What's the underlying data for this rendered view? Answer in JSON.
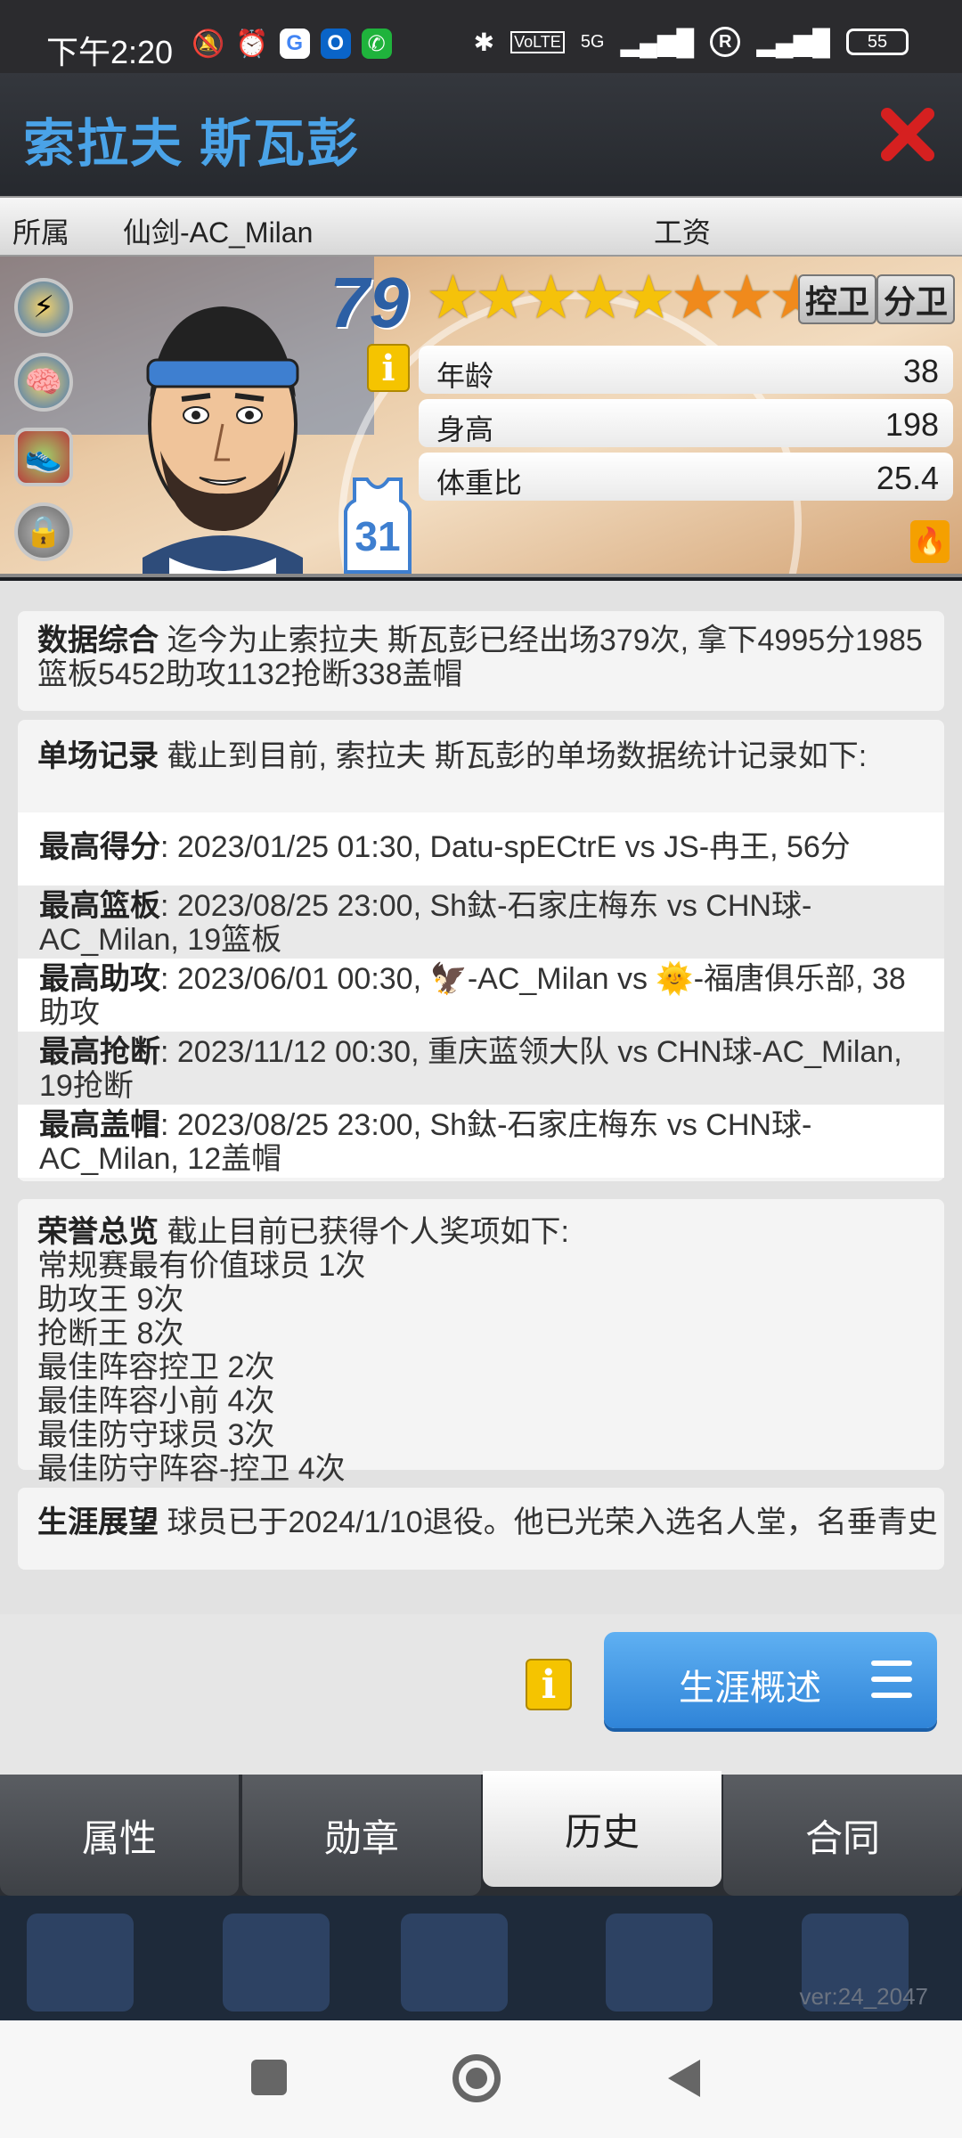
{
  "status_bar": {
    "time": "下午2:20",
    "network": "5G",
    "battery": "55",
    "registered_mark": "R"
  },
  "header": {
    "title": "索拉夫 斯瓦彭",
    "accent_color": "#4aa3e8",
    "close_icon_color": "#d62020"
  },
  "info_row": {
    "team_label": "所属",
    "team_value": "仙剑-AC_Milan",
    "salary_label": "工资"
  },
  "player": {
    "rating": "79",
    "stars_gold": 5,
    "stars_orange": 3,
    "positions": [
      "控卫",
      "分卫"
    ],
    "jersey_number": "31",
    "stats": [
      {
        "label": "年龄",
        "value": "38"
      },
      {
        "label": "身高",
        "value": "198"
      },
      {
        "label": "体重比",
        "value": "25.4"
      }
    ],
    "info_button": "i"
  },
  "summary": {
    "heading": "数据综合",
    "text": " 迄今为止索拉夫 斯瓦彭已经出场379次, 拿下4995分1985篮板5452助攻1132抢断338盖帽"
  },
  "records": {
    "heading": "单场记录",
    "intro": " 截止到目前, 索拉夫 斯瓦彭的单场数据统计记录如下:",
    "items": [
      {
        "label": "最高得分",
        "text": ": 2023/01/25 01:30, Datu-spECtrE vs JS-冉王, 56分"
      },
      {
        "label": "最高篮板",
        "text": ": 2023/08/25 23:00, Sh鈦-石家庄梅东 vs CHN球-AC_Milan, 19篮板"
      },
      {
        "label": "最高助攻",
        "text": ": 2023/06/01 00:30, 🦅-AC_Milan vs 🌞-福唐俱乐部, 38助攻"
      },
      {
        "label": "最高抢断",
        "text": ": 2023/11/12 00:30, 重庆蓝领大队 vs CHN球-AC_Milan, 19抢断"
      },
      {
        "label": "最高盖帽",
        "text": ": 2023/08/25 23:00, Sh鈦-石家庄梅东 vs CHN球-AC_Milan, 12盖帽"
      }
    ]
  },
  "honors": {
    "heading": "荣誉总览",
    "intro": " 截止目前已获得个人奖项如下:",
    "items": [
      "常规赛最有价值球员  1次",
      "助攻王  9次",
      "抢断王  8次",
      "最佳阵容控卫  2次",
      "最佳阵容小前  4次",
      "最佳防守球员  3次",
      "最佳防守阵容-控卫  4次"
    ]
  },
  "career": {
    "heading": "生涯展望",
    "text": " 球员已于2024/1/10退役。他已光荣入选名人堂，名垂青史"
  },
  "bottom": {
    "info_button": "i",
    "career_button": "生涯概述"
  },
  "tabs": [
    {
      "label": "属性",
      "active": false
    },
    {
      "label": "勋章",
      "active": false
    },
    {
      "label": "历史",
      "active": true
    },
    {
      "label": "合同",
      "active": false
    }
  ],
  "version": "ver:24_2047"
}
